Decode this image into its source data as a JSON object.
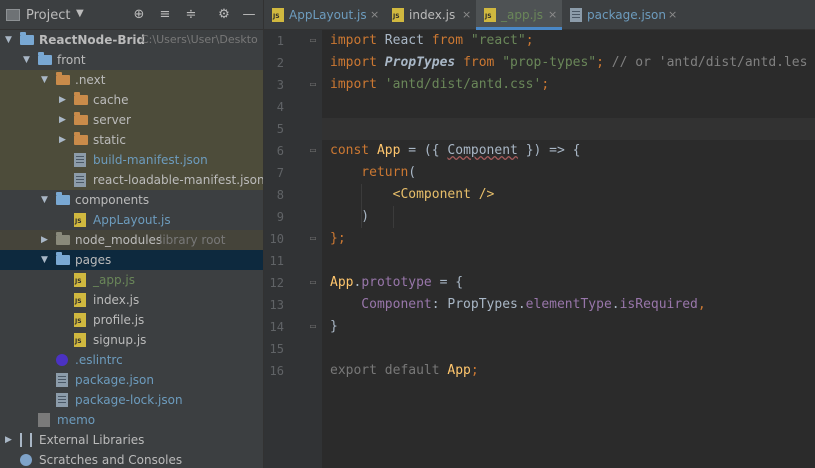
{
  "project_pane": {
    "title": "Project",
    "caret": "▼",
    "buttons": {
      "locate": "⊕",
      "expand": "≡",
      "collapse": "≑",
      "settings": "⚙",
      "hide": "—"
    },
    "tree": [
      {
        "label": "ReactNode-Brid",
        "path": "C:\\Users\\User\\Deskto",
        "type": "project",
        "depth": 0,
        "arrow": "down",
        "bold": true
      },
      {
        "label": "front",
        "type": "folder",
        "depth": 1,
        "arrow": "down"
      },
      {
        "label": ".next",
        "type": "folder-orange",
        "depth": 2,
        "arrow": "down",
        "band": "sel"
      },
      {
        "label": "cache",
        "type": "folder-orange",
        "depth": 3,
        "arrow": "right",
        "band": "sel"
      },
      {
        "label": "server",
        "type": "folder-orange",
        "depth": 3,
        "arrow": "right",
        "band": "sel"
      },
      {
        "label": "static",
        "type": "folder-orange",
        "depth": 3,
        "arrow": "right",
        "band": "sel"
      },
      {
        "label": "build-manifest.json",
        "type": "json",
        "depth": 3,
        "color": "blue",
        "band": "sel"
      },
      {
        "label": "react-loadable-manifest.json",
        "type": "json",
        "depth": 3,
        "band": "sel"
      },
      {
        "label": "components",
        "type": "folder",
        "depth": 2,
        "arrow": "down"
      },
      {
        "label": "AppLayout.js",
        "type": "js",
        "depth": 3,
        "color": "blue"
      },
      {
        "label": "node_modules",
        "hint": "library root",
        "type": "folder-grey",
        "depth": 2,
        "arrow": "right",
        "band": "lib"
      },
      {
        "label": "pages",
        "type": "folder",
        "depth": 2,
        "arrow": "down",
        "band": "active"
      },
      {
        "label": "_app.js",
        "type": "js",
        "depth": 3,
        "color": "green"
      },
      {
        "label": "index.js",
        "type": "js",
        "depth": 3
      },
      {
        "label": "profile.js",
        "type": "js",
        "depth": 3
      },
      {
        "label": "signup.js",
        "type": "js",
        "depth": 3
      },
      {
        "label": ".eslintrc",
        "type": "eslint",
        "depth": 2,
        "color": "blue"
      },
      {
        "label": "package.json",
        "type": "json",
        "depth": 2,
        "color": "blue"
      },
      {
        "label": "package-lock.json",
        "type": "json",
        "depth": 2,
        "color": "blue"
      },
      {
        "label": "memo",
        "type": "memo",
        "depth": 1,
        "color": "blue"
      },
      {
        "label": "External Libraries",
        "type": "libs",
        "depth": 0,
        "arrow": "right"
      },
      {
        "label": "Scratches and Consoles",
        "type": "scratch",
        "depth": 0
      }
    ]
  },
  "editor": {
    "tabs": [
      {
        "name": "AppLayout.js",
        "color": "blue",
        "close": "×"
      },
      {
        "name": "index.js",
        "color": "",
        "close": "×"
      },
      {
        "name": "_app.js",
        "color": "green",
        "close": "×",
        "active": true
      },
      {
        "name": "package.json",
        "color": "blue",
        "close": "×"
      }
    ],
    "line_numbers": [
      "1",
      "2",
      "3",
      "4",
      "5",
      "6",
      "7",
      "8",
      "9",
      "10",
      "11",
      "12",
      "13",
      "14",
      "15",
      "16"
    ],
    "code_lines": [
      [
        {
          "t": "import ",
          "c": "kw"
        },
        {
          "t": "React ",
          "c": "id"
        },
        {
          "t": "from ",
          "c": "kw"
        },
        {
          "t": "\"react\"",
          "c": "str"
        },
        {
          "t": ";",
          "c": "kw"
        }
      ],
      [
        {
          "t": "import ",
          "c": "kw"
        },
        {
          "t": "PropTypes ",
          "c": "ital"
        },
        {
          "t": "from ",
          "c": "kw"
        },
        {
          "t": "\"prop-types\"",
          "c": "str"
        },
        {
          "t": "; ",
          "c": "kw"
        },
        {
          "t": "// or 'antd/dist/antd.les",
          "c": "cm"
        }
      ],
      [
        {
          "t": "import ",
          "c": "kw"
        },
        {
          "t": "'antd/dist/antd.css'",
          "c": "str"
        },
        {
          "t": ";",
          "c": "kw"
        }
      ],
      [],
      [],
      [
        {
          "t": "const ",
          "c": "kw"
        },
        {
          "t": "App",
          "c": "fn"
        },
        {
          "t": " = ({ ",
          "c": "id"
        },
        {
          "t": "Component",
          "c": "id squig"
        },
        {
          "t": " }) => {",
          "c": "id"
        }
      ],
      [
        {
          "t": "    return",
          "c": "kw"
        },
        {
          "t": "(",
          "c": "id"
        }
      ],
      [
        {
          "t": "        ",
          "c": "id"
        },
        {
          "t": "<Component />",
          "c": "tag"
        }
      ],
      [
        {
          "t": "    )",
          "c": "id"
        }
      ],
      [
        {
          "t": "};",
          "c": "kw"
        }
      ],
      [],
      [
        {
          "t": "App",
          "c": "fn"
        },
        {
          "t": ".",
          "c": "id"
        },
        {
          "t": "prototype",
          "c": "prop"
        },
        {
          "t": " = {",
          "c": "id"
        }
      ],
      [
        {
          "t": "    Component",
          "c": "prop"
        },
        {
          "t": ": PropTypes.",
          "c": "id"
        },
        {
          "t": "elementType",
          "c": "prop"
        },
        {
          "t": ".",
          "c": "id"
        },
        {
          "t": "isRequired",
          "c": "prop"
        },
        {
          "t": ",",
          "c": "kw"
        }
      ],
      [
        {
          "t": "}",
          "c": "id"
        }
      ],
      [],
      [
        {
          "t": "export default ",
          "c": "dim"
        },
        {
          "t": "App",
          "c": "fn"
        },
        {
          "t": ";",
          "c": "kw"
        }
      ]
    ]
  },
  "colors": {
    "accent": "#4a88c7",
    "js_green": "#6a8759",
    "link_blue": "#6d9cbe"
  }
}
